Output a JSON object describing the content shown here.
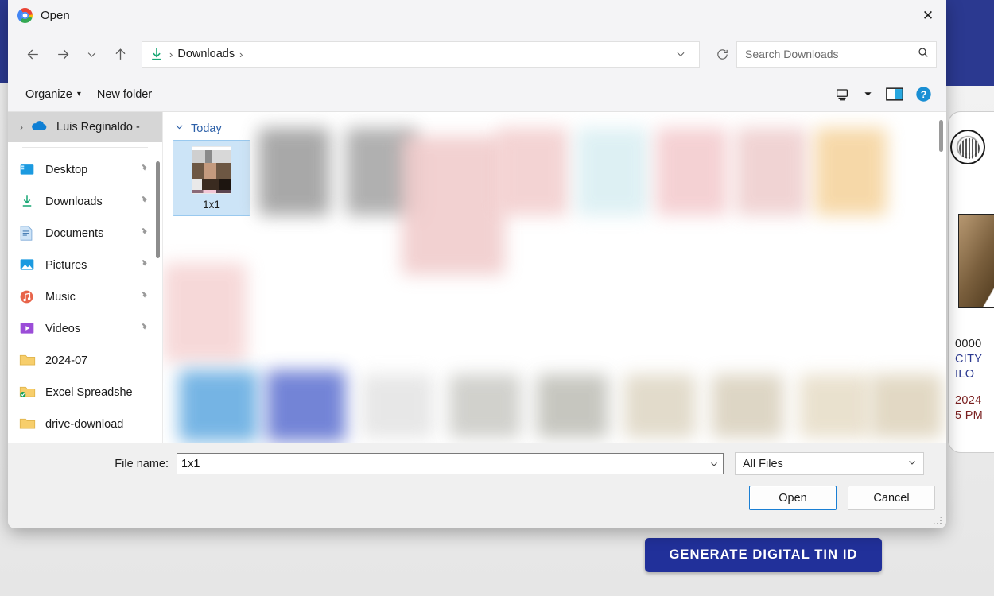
{
  "background": {
    "generate_button_label": "GENERATE DIGITAL TIN ID",
    "accent_navy": "#21309a",
    "id_card": {
      "line1": "0000",
      "line2": "CITY",
      "line3": "ILO",
      "line4": "2024",
      "line5": "5 PM"
    }
  },
  "dialog": {
    "title": "Open",
    "close_label": "✕",
    "nav": {
      "back": "←",
      "forward": "→",
      "recent": "⌄",
      "up": "↑",
      "address_chevron": "⌄",
      "refresh": "↻"
    },
    "breadcrumb": {
      "icon": "downloads-icon",
      "current": "Downloads",
      "separator": "›"
    },
    "search": {
      "placeholder": "Search Downloads",
      "value": "",
      "icon": "search-icon"
    },
    "commandbar": {
      "organize_label": "Organize",
      "organize_caret": "▾",
      "new_folder_label": "New folder",
      "view_icon": "view-layout-icon",
      "view_caret": "▾",
      "preview_pane_icon": "preview-pane-icon",
      "help_icon": "help-icon",
      "help_glyph": "?"
    },
    "sidebar": {
      "onedrive": {
        "label": "Luis Reginaldo -",
        "chevron": "›",
        "icon": "onedrive-cloud-icon"
      },
      "items": [
        {
          "label": "Desktop",
          "icon": "desktop-icon",
          "pinned": true
        },
        {
          "label": "Downloads",
          "icon": "downloads-icon",
          "pinned": true
        },
        {
          "label": "Documents",
          "icon": "documents-icon",
          "pinned": true
        },
        {
          "label": "Pictures",
          "icon": "pictures-icon",
          "pinned": true
        },
        {
          "label": "Music",
          "icon": "music-icon",
          "pinned": true
        },
        {
          "label": "Videos",
          "icon": "videos-icon",
          "pinned": true
        },
        {
          "label": "2024-07",
          "icon": "folder-icon",
          "pinned": false
        },
        {
          "label": "Excel Spreadshe",
          "icon": "folder-sync-icon",
          "pinned": false
        },
        {
          "label": "drive-download",
          "icon": "folder-icon",
          "pinned": false
        }
      ],
      "pin_glyph": "✒"
    },
    "files": {
      "group_label": "Today",
      "group_chevron": "⌄",
      "items": [
        {
          "label": "1x1",
          "selected": true
        }
      ]
    },
    "footer": {
      "file_name_label": "File name:",
      "file_name_value": "1x1",
      "file_name_caret": "⌄",
      "file_type_value": "All Files",
      "file_type_caret": "⌄",
      "open_label": "Open",
      "cancel_label": "Cancel"
    }
  }
}
